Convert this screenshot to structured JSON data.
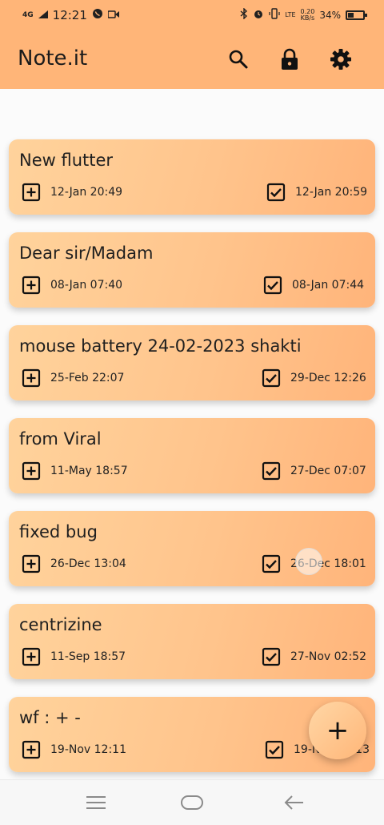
{
  "status_bar": {
    "network": "4G",
    "time": "12:21",
    "data_speed_top": "0.20",
    "data_speed_bottom": "KB/s",
    "network_type": "LTE",
    "battery": "34%"
  },
  "app_bar": {
    "title": "Note.it",
    "icons": [
      "search-icon",
      "lock-icon",
      "settings-icon"
    ]
  },
  "notes": [
    {
      "title": "New flutter",
      "created": "12-Jan 20:49",
      "edited": "12-Jan 20:59"
    },
    {
      "title": "Dear sir/Madam",
      "created": "08-Jan 07:40",
      "edited": "08-Jan 07:44"
    },
    {
      "title": "mouse battery 24-02-2023 shakti",
      "created": "25-Feb 22:07",
      "edited": "29-Dec 12:26"
    },
    {
      "title": "from Viral",
      "created": "11-May 18:57",
      "edited": "27-Dec 07:07"
    },
    {
      "title": "fixed bug",
      "created": "26-Dec 13:04",
      "edited": "26-Dec 18:01"
    },
    {
      "title": "centrizine",
      "created": "11-Sep 18:57",
      "edited": "27-Nov 02:52"
    },
    {
      "title": "wf : + -",
      "created": "19-Nov 12:11",
      "edited": "19-Nov 12:13"
    }
  ],
  "fab": {
    "label": "+"
  },
  "colors": {
    "app_bar": "#ffb578",
    "card_start": "#ffd39c",
    "card_end": "#ffb47a"
  },
  "nav_bar": {
    "icons": [
      "recents-icon",
      "home-icon",
      "back-icon"
    ]
  }
}
